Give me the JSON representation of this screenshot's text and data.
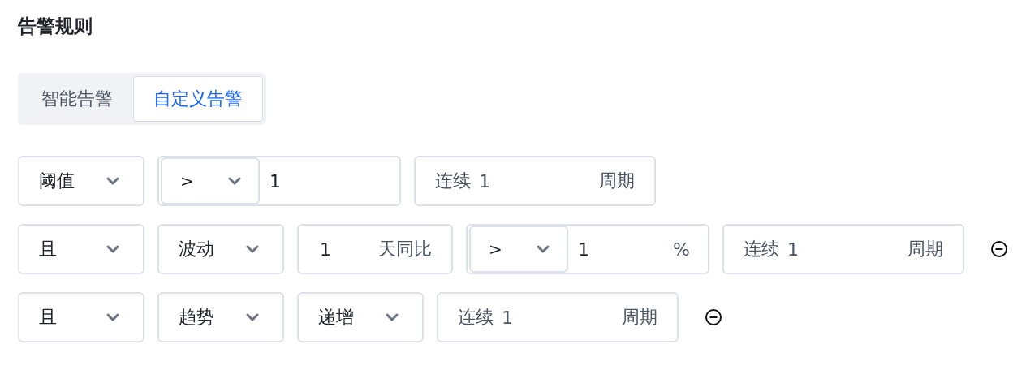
{
  "title": "告警规则",
  "tabs": [
    {
      "label": "智能告警",
      "selected": false
    },
    {
      "label": "自定义告警",
      "selected": true
    }
  ],
  "rules": [
    {
      "removable": false,
      "controls": [
        {
          "kind": "select",
          "value": "阈值"
        },
        {
          "kind": "compare",
          "operator": ">",
          "value": "1"
        },
        {
          "kind": "streak",
          "prefix": "连续",
          "value": "1",
          "suffix": "周期"
        }
      ]
    },
    {
      "removable": true,
      "controls": [
        {
          "kind": "select",
          "value": "且"
        },
        {
          "kind": "select",
          "value": "波动"
        },
        {
          "kind": "number",
          "value": "1",
          "suffix": "天同比"
        },
        {
          "kind": "compare",
          "operator": ">",
          "value": "1",
          "suffix": "%"
        },
        {
          "kind": "streak",
          "prefix": "连续",
          "value": "1",
          "suffix": "周期"
        }
      ]
    },
    {
      "removable": true,
      "controls": [
        {
          "kind": "select",
          "value": "且"
        },
        {
          "kind": "select",
          "value": "趋势"
        },
        {
          "kind": "select",
          "value": "递增"
        },
        {
          "kind": "streak",
          "prefix": "连续",
          "value": "1",
          "suffix": "周期"
        }
      ]
    }
  ]
}
